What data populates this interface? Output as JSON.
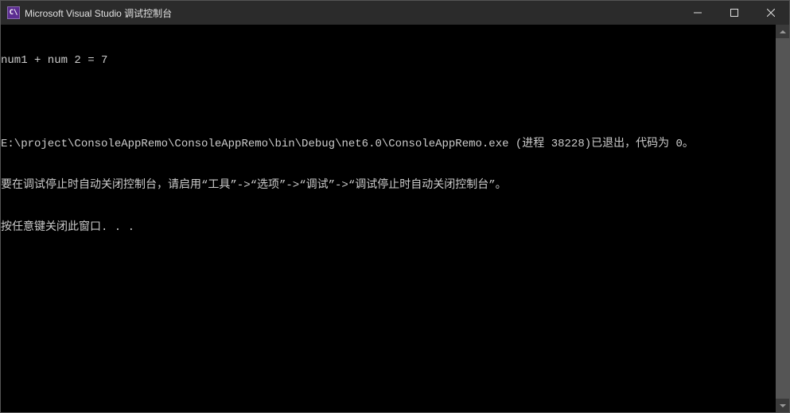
{
  "window": {
    "title": "Microsoft Visual Studio 调试控制台",
    "icon_text": "C\\"
  },
  "console": {
    "lines": [
      "num1 + num 2 = 7",
      "",
      "E:\\project\\ConsoleAppRemo\\ConsoleAppRemo\\bin\\Debug\\net6.0\\ConsoleAppRemo.exe (进程 38228)已退出，代码为 0。",
      "要在调试停止时自动关闭控制台，请启用“工具”->“选项”->“调试”->“调试停止时自动关闭控制台”。",
      "按任意键关闭此窗口. . ."
    ]
  }
}
